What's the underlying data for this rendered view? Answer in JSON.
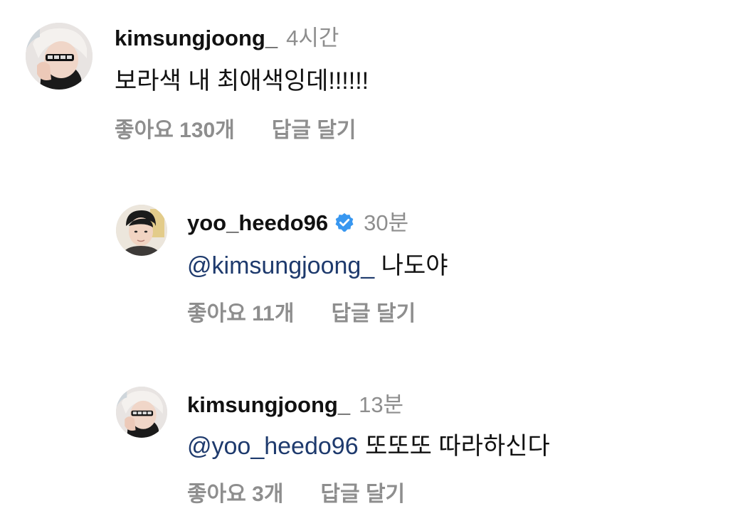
{
  "comments": [
    {
      "username": "kimsungjoong_",
      "time": "4시간",
      "text": "보라색 내 최애색잉데!!!!!!",
      "likes_label": "좋아요 130개",
      "reply_label": "답글 달기",
      "avatar_icon": "profile-photo-white-hair-sunglasses"
    },
    {
      "username": "yoo_heedo96",
      "verified": true,
      "verified_icon": "verified-badge-icon",
      "verified_color": "#3897f0",
      "time": "30분",
      "mention": "@kimsungjoong_",
      "text": "나도야",
      "likes_label": "좋아요 11개",
      "reply_label": "답글 달기",
      "avatar_icon": "profile-photo-dark-hair"
    },
    {
      "username": "kimsungjoong_",
      "time": "13분",
      "mention": "@yoo_heedo96",
      "text": "또또또 따라하신다",
      "likes_label": "좋아요 3개",
      "reply_label": "답글 달기",
      "avatar_icon": "profile-photo-white-hair-sunglasses"
    }
  ],
  "colors": {
    "mention": "#1e3a6d",
    "meta": "#8e8e8e",
    "text": "#111111"
  }
}
